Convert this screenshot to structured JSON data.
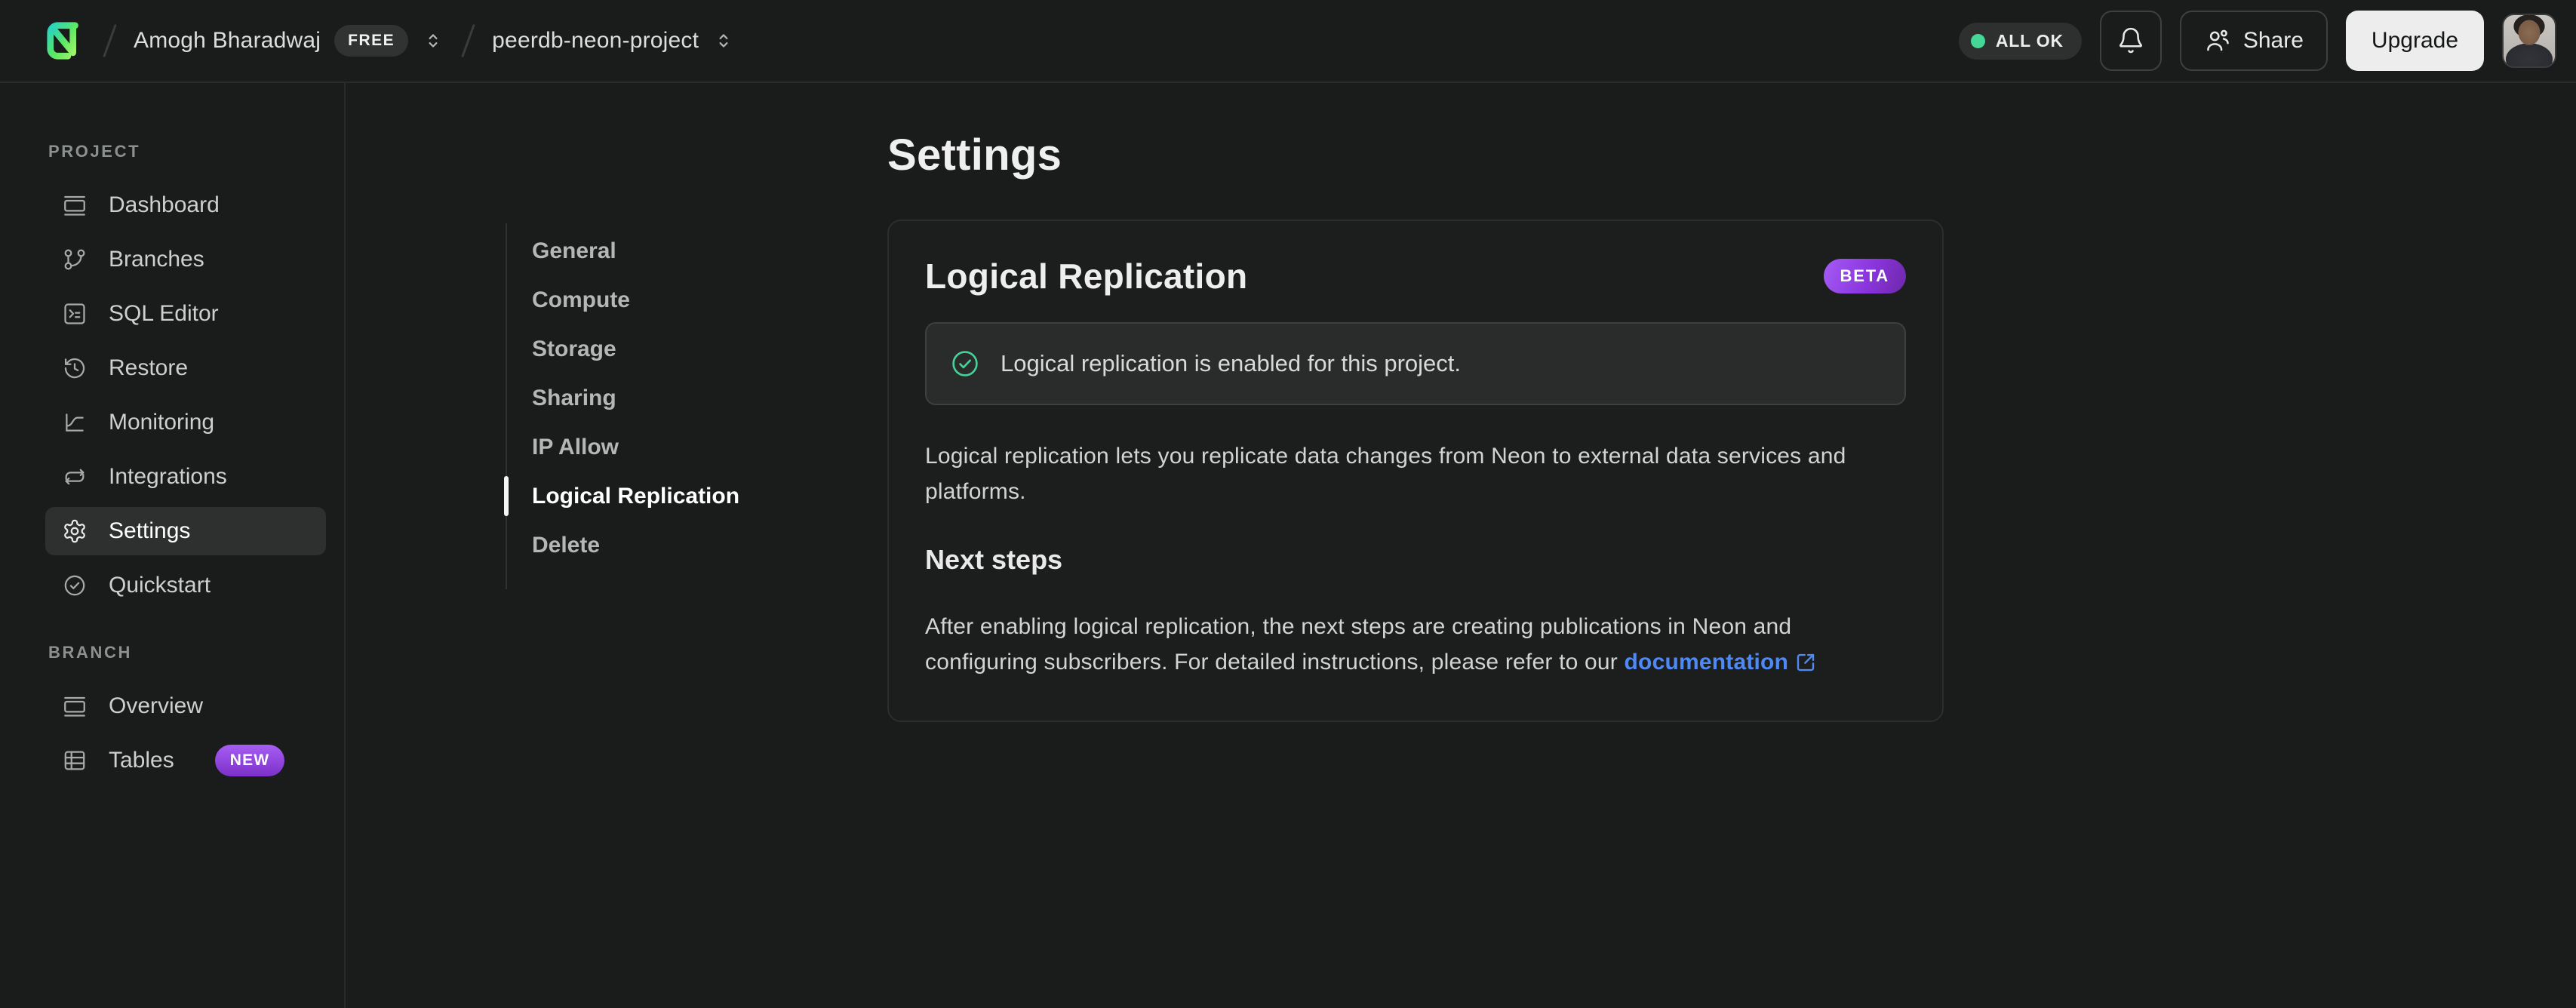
{
  "topbar": {
    "org": {
      "name": "Amogh Bharadwaj",
      "plan_badge": "FREE"
    },
    "project": {
      "name": "peerdb-neon-project"
    },
    "status_label": "ALL OK",
    "share_label": "Share",
    "upgrade_label": "Upgrade"
  },
  "sidebar": {
    "sections": [
      {
        "label": "PROJECT",
        "items": [
          {
            "label": "Dashboard",
            "icon": "dashboard-icon",
            "active": false
          },
          {
            "label": "Branches",
            "icon": "git-branch-icon",
            "active": false
          },
          {
            "label": "SQL Editor",
            "icon": "sql-terminal-icon",
            "active": false
          },
          {
            "label": "Restore",
            "icon": "history-icon",
            "active": false
          },
          {
            "label": "Monitoring",
            "icon": "chart-icon",
            "active": false
          },
          {
            "label": "Integrations",
            "icon": "integrations-icon",
            "active": false
          },
          {
            "label": "Settings",
            "icon": "gear-icon",
            "active": true
          },
          {
            "label": "Quickstart",
            "icon": "check-circle-icon",
            "active": false
          }
        ]
      },
      {
        "label": "BRANCH",
        "items": [
          {
            "label": "Overview",
            "icon": "overview-icon",
            "active": false
          },
          {
            "label": "Tables",
            "icon": "table-icon",
            "badge": "NEW",
            "active": false
          }
        ]
      }
    ]
  },
  "settings_nav": {
    "items": [
      {
        "label": "General",
        "active": false
      },
      {
        "label": "Compute",
        "active": false
      },
      {
        "label": "Storage",
        "active": false
      },
      {
        "label": "Sharing",
        "active": false
      },
      {
        "label": "IP Allow",
        "active": false
      },
      {
        "label": "Logical Replication",
        "active": true
      },
      {
        "label": "Delete",
        "active": false
      }
    ]
  },
  "page": {
    "title": "Settings"
  },
  "card": {
    "title": "Logical Replication",
    "badge": "BETA",
    "alert_text": "Logical replication is enabled for this project.",
    "intro": "Logical replication lets you replicate data changes from Neon to external data services and platforms.",
    "next_steps_heading": "Next steps",
    "next_steps_text": "After enabling logical replication, the next steps are creating publications in Neon and configuring subscribers. For detailed instructions, please refer to our ",
    "doc_link_label": "documentation"
  },
  "colors": {
    "brand_green": "#45d795",
    "badge_purple": "#a55bf4",
    "link_blue": "#4e89f5",
    "page_bg": "#1a1b1b"
  }
}
